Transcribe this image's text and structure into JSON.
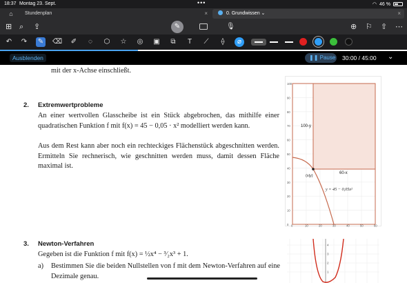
{
  "status": {
    "time": "18:37",
    "date": "Montag 23. Sept.",
    "dots": "•••",
    "battery": "46 %"
  },
  "tabs": [
    {
      "label": "Stundenplan"
    },
    {
      "label": "0. Grundwissen"
    }
  ],
  "session": {
    "hide_label": "Ausblenden",
    "pause_label": "Pause",
    "timer": "30:00 / 45:00"
  },
  "colors": {
    "accent": "#2f9ef8",
    "swatches": [
      "#e02020",
      "#2f9ef8",
      "#3bbf3b",
      "#111111"
    ]
  },
  "icons": {
    "toolbar": [
      "home-icon",
      "grid-icon",
      "search-icon",
      "share-icon",
      "pen-mode-icon",
      "keyboard-icon",
      "mic-icon",
      "add-page-icon",
      "bookmark-icon",
      "export-icon",
      "more-icon"
    ],
    "drawing": [
      "undo-icon",
      "redo-icon",
      "pen-icon",
      "eraser-icon",
      "highlighter-icon",
      "lasso-icon",
      "shapes-icon",
      "image-icon",
      "text-icon",
      "sticker-icon",
      "ruler-icon",
      "laser-icon"
    ]
  },
  "doc": {
    "prev_line": "mit der x-Achse einschließt.",
    "s2": {
      "num": "2.",
      "title": "Extremwertprobleme",
      "p1": "An einer wertvollen Glasscheibe ist ein Stück abgebrochen, das mithilfe einer quadratischen Funktion f mit f(x) = 45 − 0,05 · x² modelliert werden kann.",
      "p2": "Aus dem Rest kann aber noch ein rechteckiges Flächenstück abgeschnitten werden. Ermitteln Sie rechnerisch, wie geschnitten werden muss, damit dessen Fläche maximal ist."
    },
    "s3": {
      "num": "3.",
      "title": "Newton-Verfahren",
      "intro": "Gegeben ist die Funktion f mit f(x) = ½x⁴ − ³⁄₂x³ + 1.",
      "a_label": "a)",
      "a_text": "Bestimmen Sie die beiden Nullstellen von f mit dem Newton-Verfahren auf eine Dezimale genau."
    }
  },
  "graph1": {
    "y_ticks": [
      "100",
      "90",
      "80",
      "70",
      "60",
      "50",
      "40",
      "30",
      "20",
      "10",
      "0"
    ],
    "x_ticks": [
      "0",
      "10",
      "20",
      "30",
      "40",
      "50",
      "60"
    ],
    "label_height": "100-y",
    "label_width": "60-x",
    "label_point": "(x|y)",
    "label_function": "y = 45 − 0,05x²"
  },
  "graph2": {
    "y_ticks": [
      "4",
      "3",
      "2",
      "1"
    ]
  }
}
